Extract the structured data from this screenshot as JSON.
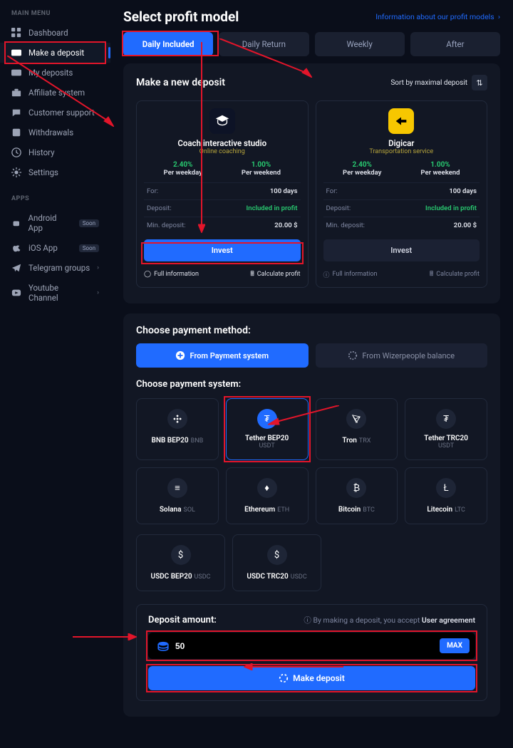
{
  "sidebar": {
    "section1": "MAIN MENU",
    "items": [
      {
        "label": "Dashboard"
      },
      {
        "label": "Make a deposit"
      },
      {
        "label": "My deposits"
      },
      {
        "label": "Affiliate system"
      },
      {
        "label": "Customer support"
      },
      {
        "label": "Withdrawals"
      },
      {
        "label": "History"
      },
      {
        "label": "Settings"
      }
    ],
    "section2": "APPS",
    "apps": [
      {
        "label": "Android App",
        "badge": "Soon"
      },
      {
        "label": "iOS App",
        "badge": "Soon"
      },
      {
        "label": "Telegram groups"
      },
      {
        "label": "Youtube Channel"
      }
    ]
  },
  "header": {
    "title": "Select profit model",
    "info": "Information about our profit models"
  },
  "tabs": [
    "Daily Included",
    "Daily Return",
    "Weekly",
    "After"
  ],
  "deposit_panel": {
    "title": "Make a new deposit",
    "sort": "Sort by maximal deposit",
    "cards": [
      {
        "name": "Coach interactive studio",
        "sub": "Online coaching",
        "wd_pct": "2.40%",
        "wd_lbl": "Per weekday",
        "we_pct": "1.00%",
        "we_lbl": "Per weekend",
        "for_k": "For:",
        "for_v": "100 days",
        "dep_k": "Deposit:",
        "dep_v": "Included in profit",
        "min_k": "Min. deposit:",
        "min_v": "20.00 $",
        "btn": "Invest",
        "full": "Full information",
        "calc": "Calculate profit"
      },
      {
        "name": "Digicar",
        "sub": "Transportation service",
        "wd_pct": "2.40%",
        "wd_lbl": "Per weekday",
        "we_pct": "1.00%",
        "we_lbl": "Per weekend",
        "for_k": "For:",
        "for_v": "100 days",
        "dep_k": "Deposit:",
        "dep_v": "Included in profit",
        "min_k": "Min. deposit:",
        "min_v": "20.00 $",
        "btn": "Invest",
        "full": "Full information",
        "calc": "Calculate profit"
      }
    ]
  },
  "payment": {
    "title": "Choose payment method:",
    "tab1": "From Payment system",
    "tab2": "From Wizerpeople balance",
    "sub": "Choose payment system:",
    "coins": [
      {
        "name": "BNB BEP20",
        "sym": "BNB"
      },
      {
        "name": "Tether BEP20",
        "sym": "USDT"
      },
      {
        "name": "Tron",
        "sym": "TRX"
      },
      {
        "name": "Tether TRC20",
        "sym": "USDT"
      },
      {
        "name": "Solana",
        "sym": "SOL"
      },
      {
        "name": "Ethereum",
        "sym": "ETH"
      },
      {
        "name": "Bitcoin",
        "sym": "BTC"
      },
      {
        "name": "Litecoin",
        "sym": "LTC"
      },
      {
        "name": "USDC BEP20",
        "sym": "USDC"
      },
      {
        "name": "USDC TRC20",
        "sym": "USDC"
      }
    ]
  },
  "deposit_amount": {
    "title": "Deposit amount:",
    "notice": "By making a deposit, you accept",
    "ua": "User agreement",
    "value": "50",
    "max": "MAX",
    "btn": "Make deposit"
  }
}
